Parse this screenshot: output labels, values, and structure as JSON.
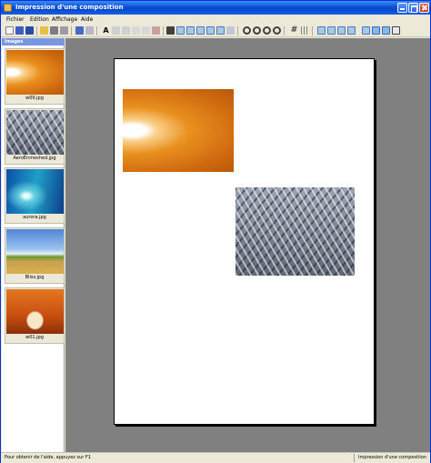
{
  "window": {
    "title": "Impression d'une composition"
  },
  "menu": [
    {
      "label": "Fichier"
    },
    {
      "label": "Edition"
    },
    {
      "label": "Affichage"
    },
    {
      "label": "Aide"
    }
  ],
  "panel": {
    "header": "Images",
    "thumbnails": [
      {
        "label": "w09.jpg"
      },
      {
        "label": "AeroEnmeshed.jpg"
      },
      {
        "label": "aurora.jpg"
      },
      {
        "label": "Bliss.jpg"
      },
      {
        "label": "w01.jpg"
      }
    ]
  },
  "status": {
    "left": "Pour obtenir de l'aide, appuyez sur F1",
    "right": "Impression d'une composition"
  },
  "toolbar_icons": [
    "new-icon",
    "open-icon",
    "save-icon",
    "folder-icon",
    "print-icon",
    "print-preview-icon",
    "undo-icon",
    "redo-icon",
    "text-icon",
    "brush-icon",
    "pen-icon",
    "eraser-icon",
    "copy-icon",
    "paste-icon",
    "align-left-icon",
    "align-center-icon",
    "align-right-icon",
    "align-top-icon",
    "align-middle-icon",
    "align-bottom-icon",
    "zoom-icon",
    "zoom-in-icon",
    "zoom-out-icon",
    "zoom-fit-icon",
    "grid-icon",
    "snap-icon",
    "layout-1-icon",
    "layout-2-icon",
    "layout-3-icon",
    "layout-4-icon",
    "rotate-icon",
    "frame-icon",
    "properties-icon"
  ]
}
